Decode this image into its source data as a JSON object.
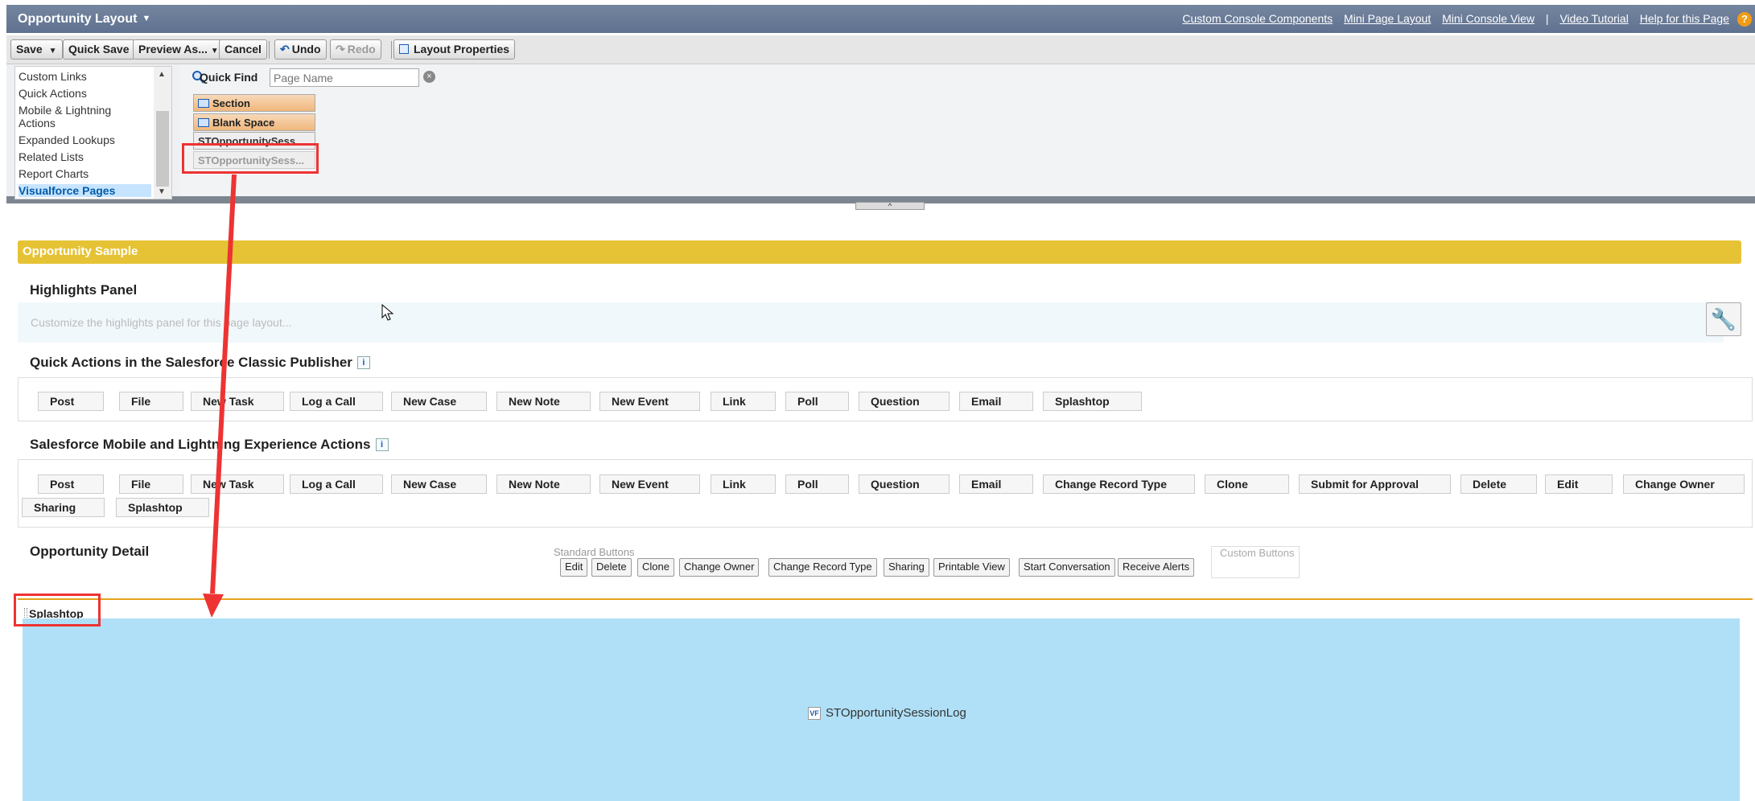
{
  "title_bar": {
    "title": "Opportunity Layout",
    "links": [
      "Custom Console Components",
      "Mini Page Layout",
      "Mini Console View",
      "Video Tutorial",
      "Help for this Page"
    ],
    "separator": "|"
  },
  "toolbar": {
    "save": "Save",
    "quick_save": "Quick Save",
    "preview_as": "Preview As...",
    "cancel": "Cancel",
    "undo": "Undo",
    "redo": "Redo",
    "layout_properties": "Layout Properties"
  },
  "palette": {
    "categories": [
      "Custom Links",
      "Quick Actions",
      "Mobile & Lightning",
      "Actions",
      "Expanded Lookups",
      "Related Lists",
      "Report Charts",
      "Visualforce Pages"
    ],
    "selected_category": "Visualforce Pages",
    "quick_find_label": "Quick Find",
    "quick_find_placeholder": "Page Name",
    "items": [
      "Section",
      "Blank Space",
      "STOpportunitySess...",
      "STOpportunitySess..."
    ]
  },
  "layout": {
    "banner": "Opportunity Sample",
    "highlights_title": "Highlights Panel",
    "highlights_hint": "Customize the highlights panel for this page layout...",
    "classic_title": "Quick Actions in the Salesforce Classic Publisher",
    "classic_actions": [
      "Post",
      "File",
      "New Task",
      "Log a Call",
      "New Case",
      "New Note",
      "New Event",
      "Link",
      "Poll",
      "Question",
      "Email",
      "Splashtop"
    ],
    "mobile_title": "Salesforce Mobile and Lightning Experience Actions",
    "mobile_actions": [
      "Post",
      "File",
      "New Task",
      "Log a Call",
      "New Case",
      "New Note",
      "New Event",
      "Link",
      "Poll",
      "Question",
      "Email",
      "Change Record Type",
      "Clone",
      "Submit for Approval",
      "Delete",
      "Edit",
      "Change Owner",
      "Sharing",
      "Splashtop"
    ],
    "detail_title": "Opportunity Detail",
    "standard_buttons_label": "Standard Buttons",
    "standard_buttons": [
      "Edit",
      "Delete",
      "Clone",
      "Change Owner",
      "Change Record Type",
      "Sharing",
      "Printable View",
      "Start Conversation",
      "Receive Alerts"
    ],
    "custom_buttons_label": "Custom Buttons",
    "section_name": "Splashtop",
    "vf_page": "STOpportunitySessionLog",
    "vf_badge": "VF"
  },
  "icons": {
    "help": "?",
    "info": "i",
    "clear": "×",
    "wrench": "wrench-icon",
    "search": "search-icon"
  },
  "colors": {
    "title_bar": "#5f7190",
    "banner": "#e6c335",
    "vf_area": "#b0e0f7",
    "annotation": "#e33333",
    "selected_category": "#c7e4ff"
  }
}
